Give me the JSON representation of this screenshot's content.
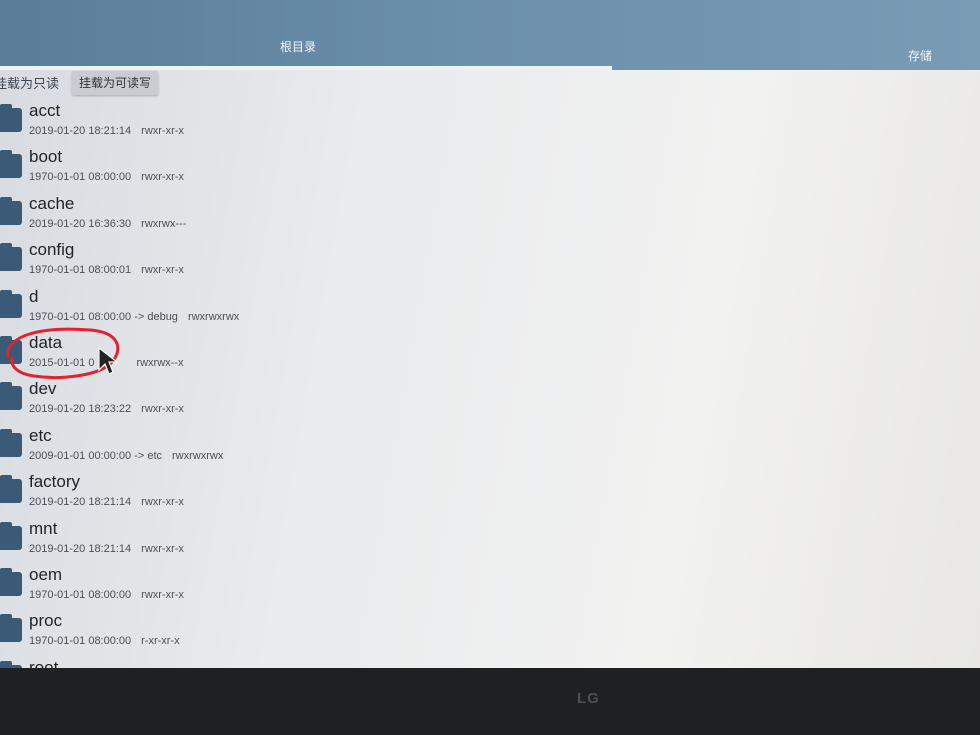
{
  "header": {
    "tab_root": "根目录",
    "tab_storage": "存储"
  },
  "mount": {
    "readonly_label": "挂载为只读",
    "readwrite_button": "挂载为可读写"
  },
  "files": [
    {
      "name": "acct",
      "meta": "2019-01-20 18:21:14",
      "perm": "rwxr-xr-x"
    },
    {
      "name": "boot",
      "meta": "1970-01-01 08:00:00",
      "perm": "rwxr-xr-x"
    },
    {
      "name": "cache",
      "meta": "2019-01-20 16:36:30",
      "perm": "rwxrwx---"
    },
    {
      "name": "config",
      "meta": "1970-01-01 08:00:01",
      "perm": "rwxr-xr-x"
    },
    {
      "name": "d",
      "meta": "1970-01-01 08:00:00  -> debug",
      "perm": "rwxrwxrwx"
    },
    {
      "name": "data",
      "meta": "2015-01-01 0",
      "perm": "rwxrwx--x"
    },
    {
      "name": "dev",
      "meta": "2019-01-20 18:23:22",
      "perm": "rwxr-xr-x"
    },
    {
      "name": "etc",
      "meta": "2009-01-01 00:00:00  -> etc",
      "perm": "rwxrwxrwx"
    },
    {
      "name": "factory",
      "meta": "2019-01-20 18:21:14",
      "perm": "rwxr-xr-x"
    },
    {
      "name": "mnt",
      "meta": "2019-01-20 18:21:14",
      "perm": "rwxr-xr-x"
    },
    {
      "name": "oem",
      "meta": "1970-01-01 08:00:00",
      "perm": "rwxr-xr-x"
    },
    {
      "name": "proc",
      "meta": "1970-01-01 08:00:00",
      "perm": "r-xr-xr-x"
    },
    {
      "name": "root",
      "meta": "",
      "perm": ""
    }
  ],
  "monitor": {
    "brand": "LG"
  },
  "colors": {
    "header_bg": "#6a8fab",
    "folder_icon": "#3b5a78",
    "annotation_red": "#e0232f"
  }
}
